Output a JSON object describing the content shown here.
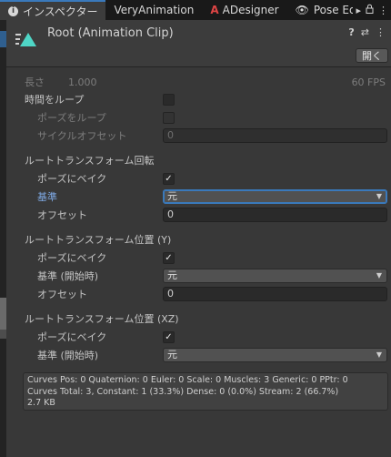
{
  "tabs": [
    {
      "label": "インスペクター",
      "icon": "info-icon"
    },
    {
      "label": "VeryAnimation"
    },
    {
      "label": "ADesigner",
      "icon": "adesigner-icon"
    },
    {
      "label": "Pose Ed",
      "icon": "eye-icon"
    }
  ],
  "tabbar_right": {
    "more": "▸",
    "lock": "🔒",
    "menu": "⋮"
  },
  "header": {
    "title": "Root (Animation Clip)",
    "help_icon": "?",
    "settings_icon": "⇄",
    "menu_icon": "⋮",
    "open_label": "開く"
  },
  "length": {
    "label": "長さ",
    "value": "1.000",
    "fps": "60 FPS"
  },
  "loop_time": {
    "label": "時間をループ"
  },
  "loop_pose": {
    "label": "ポーズをループ"
  },
  "cycle_offset": {
    "label": "サイクルオフセット",
    "value": "0"
  },
  "root_rotation": {
    "title": "ルートトランスフォーム回転",
    "bake_label": "ポーズにベイク",
    "bake_check": "✓",
    "basis_label": "基準",
    "basis_value": "元",
    "offset_label": "オフセット",
    "offset_value": "0"
  },
  "root_position_y": {
    "title": "ルートトランスフォーム位置 (Y)",
    "bake_label": "ポーズにベイク",
    "bake_check": "✓",
    "basis_label": "基準 (開始時)",
    "basis_value": "元",
    "offset_label": "オフセット",
    "offset_value": "0"
  },
  "root_position_xz": {
    "title": "ルートトランスフォーム位置 (XZ)",
    "bake_label": "ポーズにベイク",
    "bake_check": "✓",
    "basis_label": "基準 (開始時)",
    "basis_value": "元"
  },
  "info": {
    "line1": "Curves Pos: 0 Quaternion: 0 Euler: 0 Scale: 0 Muscles: 3 Generic: 0 PPtr: 0",
    "line2": "Curves Total: 3, Constant: 1 (33.3%) Dense: 0 (0.0%) Stream: 2 (66.7%)",
    "line3": "2.7 KB"
  },
  "colors": {
    "accent": "#3a79bb",
    "clip_icon": "#4fd6c6",
    "blue_label": "#7ea8e3"
  }
}
